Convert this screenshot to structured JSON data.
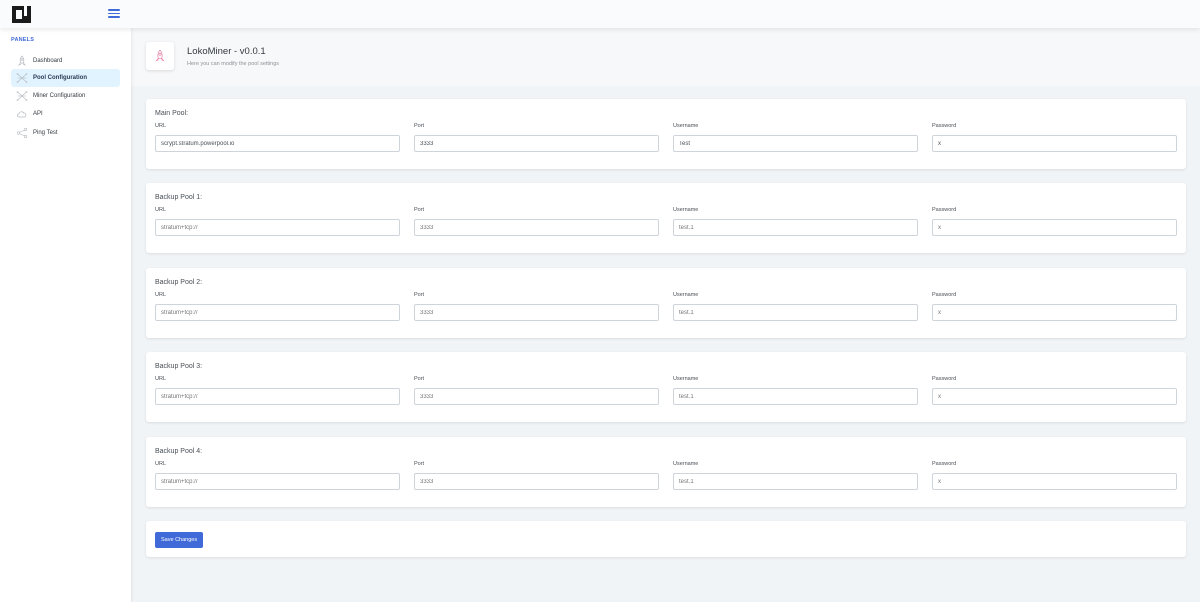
{
  "sidebar": {
    "heading": "PANELS",
    "items": [
      {
        "label": "Dashboard",
        "icon": "rocket-icon",
        "active": false
      },
      {
        "label": "Pool Configuration",
        "icon": "network-icon",
        "active": true
      },
      {
        "label": "Miner Configuration",
        "icon": "network-icon",
        "active": false
      },
      {
        "label": "API",
        "icon": "cloud-icon",
        "active": false
      },
      {
        "label": "Ping Test",
        "icon": "share-icon",
        "active": false
      }
    ]
  },
  "header": {
    "title": "LokoMiner - v0.0.1",
    "subtitle": "Here you can modify the pool settings",
    "icon": "rocket-icon"
  },
  "pools": [
    {
      "title": "Main Pool:",
      "url_label": "URL",
      "url": "scrypt.stratum.powerpool.io",
      "url_placeholder": "",
      "port_label": "Port",
      "port": "3333",
      "port_placeholder": "",
      "username_label": "Username",
      "username": "Test",
      "username_placeholder": "",
      "password_label": "Password",
      "password": "x",
      "password_placeholder": ""
    },
    {
      "title": "Backup Pool 1:",
      "url_label": "URL",
      "url": "",
      "url_placeholder": "stratum+tcp://",
      "port_label": "Port",
      "port": "",
      "port_placeholder": "3333",
      "username_label": "Username",
      "username": "",
      "username_placeholder": "test.1",
      "password_label": "Password",
      "password": "",
      "password_placeholder": "x"
    },
    {
      "title": "Backup Pool 2:",
      "url_label": "URL",
      "url": "",
      "url_placeholder": "stratum+tcp://",
      "port_label": "Port",
      "port": "",
      "port_placeholder": "3333",
      "username_label": "Username",
      "username": "",
      "username_placeholder": "test.1",
      "password_label": "Password",
      "password": "",
      "password_placeholder": "x"
    },
    {
      "title": "Backup Pool 3:",
      "url_label": "URL",
      "url": "",
      "url_placeholder": "stratum+tcp://",
      "port_label": "Port",
      "port": "",
      "port_placeholder": "3333",
      "username_label": "Username",
      "username": "",
      "username_placeholder": "test.1",
      "password_label": "Password",
      "password": "",
      "password_placeholder": "x"
    },
    {
      "title": "Backup Pool 4:",
      "url_label": "URL",
      "url": "",
      "url_placeholder": "stratum+tcp://",
      "port_label": "Port",
      "port": "",
      "port_placeholder": "3333",
      "username_label": "Username",
      "username": "",
      "username_placeholder": "test.1",
      "password_label": "Password",
      "password": "",
      "password_placeholder": "x"
    }
  ],
  "save_button_label": "Save Changes",
  "colors": {
    "accent": "#3f6ad8",
    "active_nav_bg": "#e0f3ff",
    "page_bg": "#f1f4f6"
  }
}
